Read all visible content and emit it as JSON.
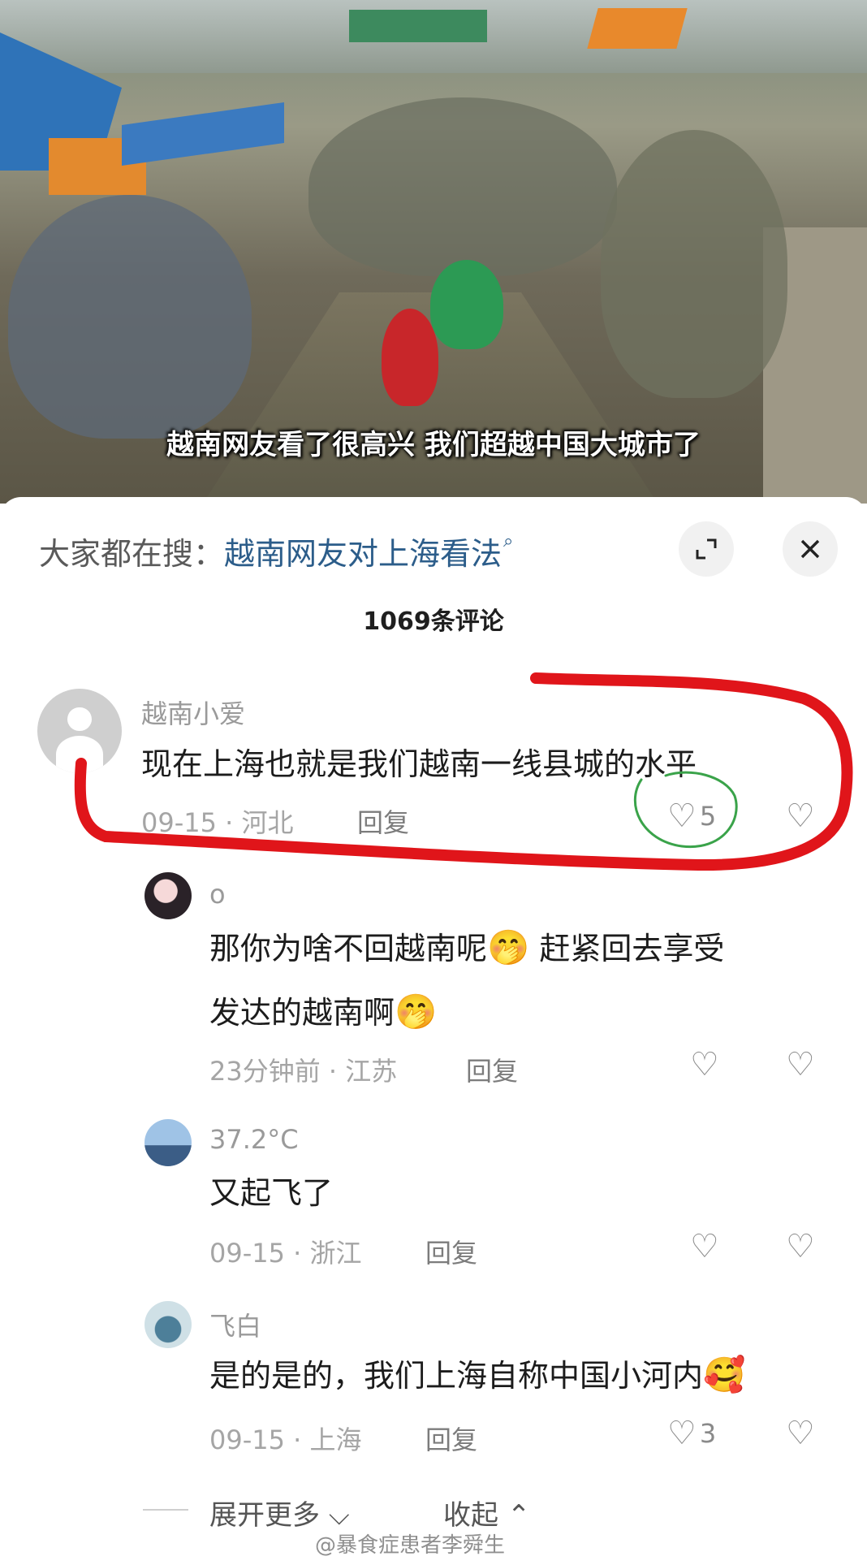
{
  "video": {
    "subtitle": "越南网友看了很高兴 我们超越中国大城市了"
  },
  "header": {
    "search_prefix": "大家都在搜：",
    "search_query": "越南网友对上海看法",
    "search_icon": "search-icon",
    "expand_icon": "expand-icon",
    "close_icon": "close-icon"
  },
  "comment_count": "1069条评论",
  "comments": [
    {
      "username": "越南小爱",
      "content": "现在上海也就是我们越南一线县城的水平",
      "date": "09-15",
      "location": "河北",
      "meta": "09-15 · 河北",
      "reply": "回复",
      "likes": "5",
      "avatar": "default-avatar"
    },
    {
      "username": "o",
      "content_line1": "那你为啥不回越南呢",
      "content_line1b": "赶紧回去享受",
      "content_line2": "发达的越南啊",
      "emoji": "🤭",
      "meta": "23分钟前 · 江苏",
      "reply": "回复",
      "likes": "",
      "avatar": "anime-avatar"
    },
    {
      "username": "37.2°C",
      "content": "又起飞了",
      "meta": "09-15 · 浙江",
      "reply": "回复",
      "likes": "",
      "avatar": "bridge-avatar"
    },
    {
      "username": "飞白",
      "content": "是的是的，我们上海自称中国小河内",
      "emoji": "🥰",
      "meta": "09-15 · 上海",
      "reply": "回复",
      "likes": "3",
      "avatar": "building-avatar"
    }
  ],
  "footer": {
    "expand_more": "展开更多",
    "collapse": "收起",
    "watermark": "@暴食症患者李舜生"
  },
  "colors": {
    "annotation_red": "#e0151a",
    "annotation_green": "#3aa34a",
    "search_link": "#2c5d8a"
  }
}
